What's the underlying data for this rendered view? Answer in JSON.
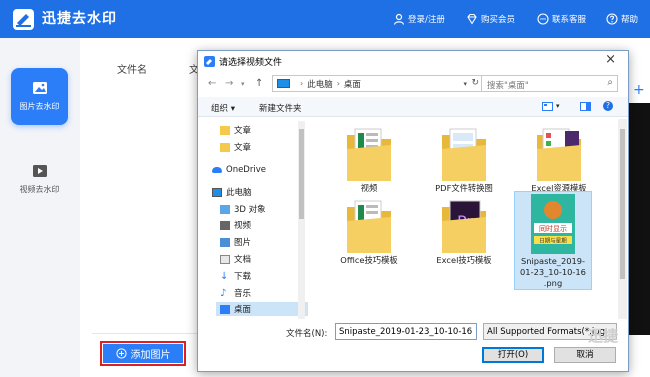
{
  "app": {
    "title": "迅捷去水印"
  },
  "header_links": [
    {
      "label": "登录/注册",
      "icon": "user-icon"
    },
    {
      "label": "购买会员",
      "icon": "diamond-icon"
    },
    {
      "label": "联系客服",
      "icon": "chat-icon"
    },
    {
      "label": "帮助",
      "icon": "help-icon"
    }
  ],
  "sidebar": {
    "items": [
      {
        "label": "图片去水印",
        "icon": "image-icon",
        "active": true
      },
      {
        "label": "视频去水印",
        "icon": "video-icon",
        "active": false
      }
    ]
  },
  "main": {
    "columns": [
      "文件名",
      "文"
    ],
    "add_button": "添加图片"
  },
  "dialog": {
    "title": "请选择视频文件",
    "close": "×",
    "address": {
      "part1": "此电脑",
      "part2": "桌面"
    },
    "search_placeholder": "搜索\"桌面\"",
    "toolbar": {
      "organize": "组织",
      "new_folder": "新建文件夹"
    },
    "nav_tree": [
      {
        "label": "文章",
        "icon": "folder-icon"
      },
      {
        "label": "文章",
        "icon": "folder-icon"
      },
      {
        "label": "OneDrive",
        "icon": "cloud-icon"
      },
      {
        "label": "此电脑",
        "icon": "computer-icon"
      },
      {
        "label": "3D 对象",
        "icon": "cube-icon"
      },
      {
        "label": "视频",
        "icon": "film-icon"
      },
      {
        "label": "图片",
        "icon": "picture-icon"
      },
      {
        "label": "文档",
        "icon": "document-icon"
      },
      {
        "label": "下载",
        "icon": "download-icon"
      },
      {
        "label": "音乐",
        "icon": "music-icon"
      },
      {
        "label": "桌面",
        "icon": "desktop-icon",
        "selected": true
      }
    ],
    "files": [
      {
        "label": "视频",
        "type": "folder"
      },
      {
        "label": "PDF文件转换图",
        "type": "folder"
      },
      {
        "label": "Excel资源模板",
        "type": "folder"
      },
      {
        "label": "Office技巧模板",
        "type": "folder"
      },
      {
        "label": "Excel技巧模板",
        "type": "folder"
      },
      {
        "label": "Snipaste_2019-01-23_10-10-16.png",
        "line1": "Snipaste_2019-",
        "line2": "01-23_10-10-16",
        "line3": ".png",
        "type": "image",
        "selected": true,
        "thumb_text1": "同时显示",
        "thumb_text2": "日期与星期"
      }
    ],
    "filename_label": "文件名(N):",
    "filename_value": "Snipaste_2019-01-23_10-10-16",
    "filetype_value": "All Supported Formats(*.jpg;",
    "open_button": "打开(O)",
    "cancel_button": "取消"
  },
  "watermark_text": "迅捷"
}
